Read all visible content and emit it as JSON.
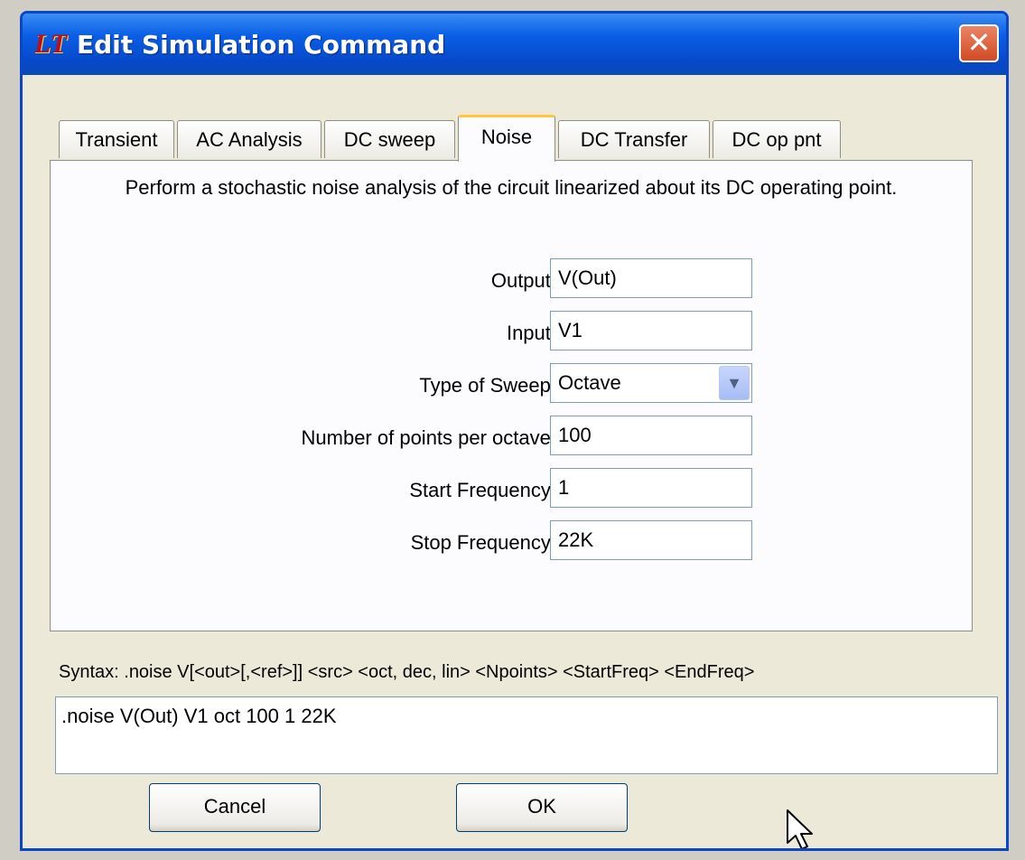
{
  "window": {
    "title": "Edit Simulation Command",
    "icon": "ltspice-logo-icon",
    "close_glyph": "✕"
  },
  "tabs": [
    {
      "label": "Transient",
      "active": false
    },
    {
      "label": "AC Analysis",
      "active": false
    },
    {
      "label": "DC sweep",
      "active": false
    },
    {
      "label": "Noise",
      "active": true
    },
    {
      "label": "DC Transfer",
      "active": false
    },
    {
      "label": "DC op pnt",
      "active": false
    }
  ],
  "panel": {
    "description": "Perform a stochastic noise analysis of the circuit linearized about its DC operating point.",
    "fields": {
      "output": {
        "label": "Output:",
        "value": "V(Out)"
      },
      "input": {
        "label": "Input:",
        "value": "V1"
      },
      "sweep_type": {
        "label": "Type of Sweep:",
        "value": "Octave"
      },
      "points": {
        "label": "Number of points per octave:",
        "value": "100"
      },
      "start_freq": {
        "label": "Start Frequency:",
        "value": "1"
      },
      "stop_freq": {
        "label": "Stop Frequency:",
        "value": "22K"
      }
    }
  },
  "syntax": "Syntax:  .noise V[<out>[,<ref>]] <src> <oct, dec, lin> <Npoints> <StartFreq> <EndFreq>",
  "command": ".noise V(Out) V1 oct 100 1 22K",
  "buttons": {
    "cancel": "Cancel",
    "ok": "OK"
  },
  "colors": {
    "titlebar": "#0a5fe6",
    "dialog_bg": "#ece9d8",
    "active_tab_accent": "#ffc83c",
    "close_button": "#d24a24"
  }
}
